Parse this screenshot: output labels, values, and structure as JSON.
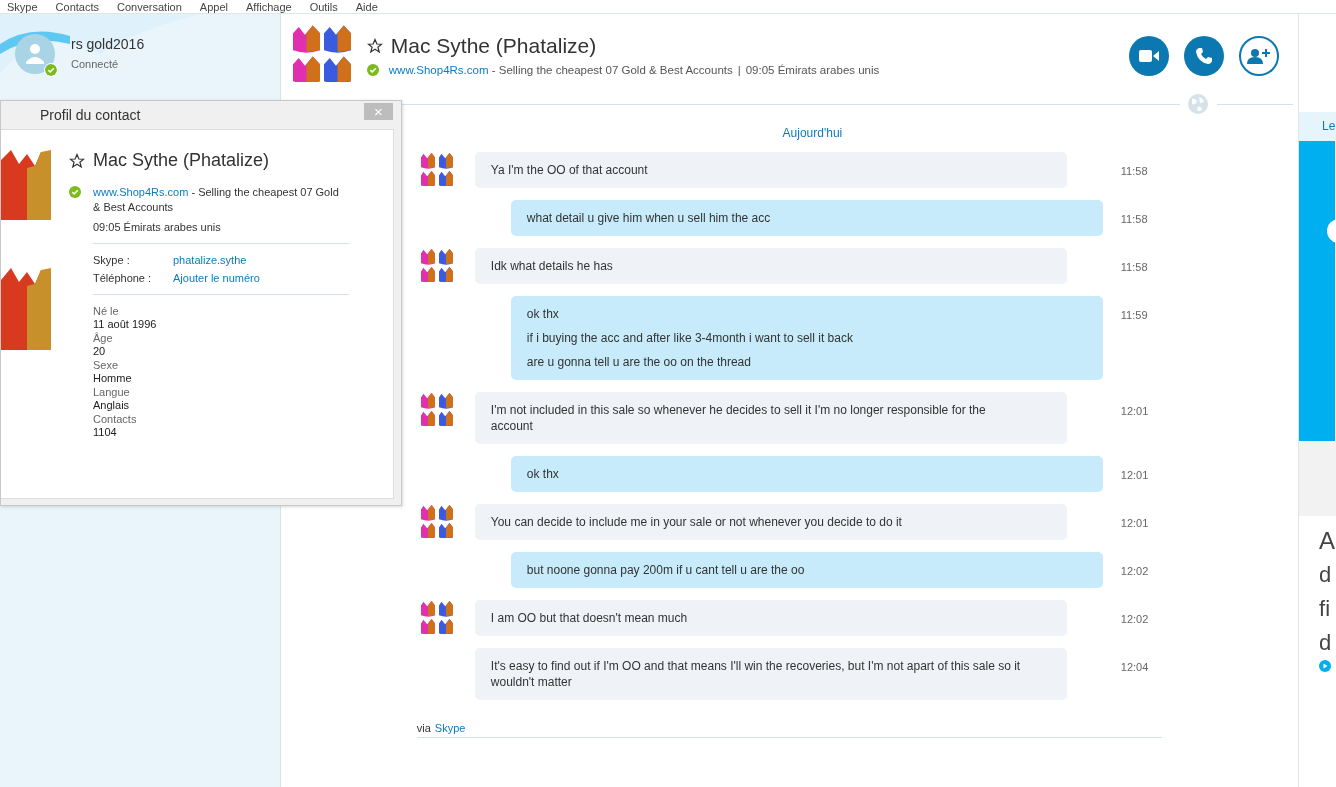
{
  "menu": [
    "Skype",
    "Contacts",
    "Conversation",
    "Appel",
    "Affichage",
    "Outils",
    "Aide"
  ],
  "me": {
    "name": "rs gold2016",
    "status": "Connecté",
    "online": true
  },
  "contact": {
    "name": "Mac Sythe (Phatalize)",
    "favorite": false,
    "online": true,
    "link": "www.Shop4Rs.com",
    "mood": " - Selling the cheapest 07 Gold & Best Accounts",
    "separator": "|",
    "local_time": "09:05 Émirats arabes unis"
  },
  "profile_popup": {
    "title": "Profil du contact",
    "close": "×",
    "name": "Mac Sythe (Phatalize)",
    "favorite": false,
    "online": true,
    "link": "www.Shop4Rs.com",
    "mood": " - Selling the cheapest 07 Gold & Best Accounts",
    "local_time": "09:05 Émirats arabes unis",
    "accounts": [
      {
        "label": "Skype :",
        "value": "phatalize.sythe"
      },
      {
        "label": "Téléphone :",
        "value": "Ajouter le numéro"
      }
    ],
    "details": [
      {
        "label": "Né le",
        "value": "11 août 1996"
      },
      {
        "label": "Âge",
        "value": "20"
      },
      {
        "label": "Sexe",
        "value": "Homme"
      },
      {
        "label": "Langue",
        "value": "Anglais"
      },
      {
        "label": "Contacts",
        "value": "1104"
      }
    ]
  },
  "day_label": "Aujourd'hui",
  "messages": [
    {
      "kind": "in",
      "avatar": true,
      "lines": [
        "Ya I'm the OO of that account"
      ],
      "time": "11:58"
    },
    {
      "kind": "out",
      "avatar": false,
      "lines": [
        "what detail u give him when u sell him the acc"
      ],
      "time": "11:58"
    },
    {
      "kind": "in",
      "avatar": true,
      "lines": [
        "Idk what details he has"
      ],
      "time": "11:58"
    },
    {
      "kind": "out",
      "avatar": false,
      "lines": [
        "ok thx",
        "if i buying the acc and after like 3-4month i want to sell it back",
        "are u gonna tell u are the oo on the thread"
      ],
      "time": "11:59"
    },
    {
      "kind": "in",
      "avatar": true,
      "lines": [
        "I'm not included in this sale so whenever he decides to sell it I'm no longer responsible for the account"
      ],
      "time": "12:01"
    },
    {
      "kind": "out",
      "avatar": false,
      "lines": [
        "ok thx"
      ],
      "time": "12:01"
    },
    {
      "kind": "in",
      "avatar": true,
      "lines": [
        "You can decide to include me in your sale or not whenever you decide to do it"
      ],
      "time": "12:01"
    },
    {
      "kind": "out",
      "avatar": false,
      "lines": [
        "but noone gonna pay 200m if u cant tell u are the oo"
      ],
      "time": "12:02"
    },
    {
      "kind": "in",
      "avatar": true,
      "lines": [
        "I am OO but that doesn't mean much"
      ],
      "time": "12:02"
    },
    {
      "kind": "in",
      "avatar": false,
      "lines": [
        "It's easy to find out if I'm OO and that means I'll win the recoveries, but I'm not apart of this sale so it wouldn't matter"
      ],
      "time": "12:04"
    }
  ],
  "via": {
    "prefix": "via",
    "link": "Skype"
  },
  "side_panel": {
    "tab": "Le",
    "lines": [
      "A",
      "d",
      "fi",
      "d"
    ]
  }
}
